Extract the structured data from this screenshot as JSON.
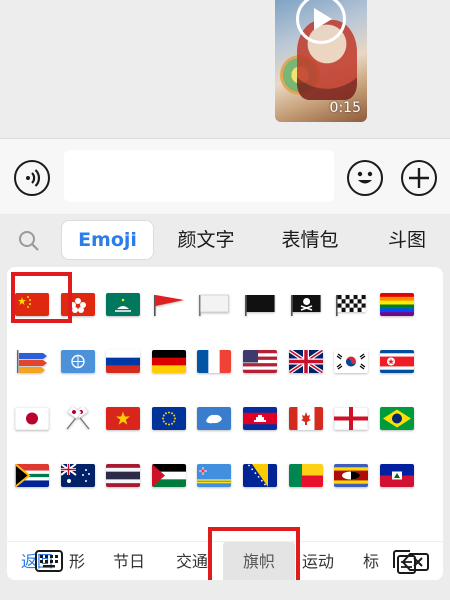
{
  "chat": {
    "video_duration": "0:15"
  },
  "input_bar": {
    "voice_icon": "voice-icon",
    "text_value": "",
    "emoji_icon": "smiley-icon",
    "plus_icon": "plus-icon"
  },
  "panel_tabs": [
    {
      "label": "Emoji",
      "active": true
    },
    {
      "label": "颜文字",
      "active": false
    },
    {
      "label": "表情包",
      "active": false
    },
    {
      "label": "斗图",
      "active": false
    }
  ],
  "flags": [
    "China",
    "Hong Kong",
    "Macau",
    "Red triangular flag",
    "White flag",
    "Black flag",
    "Pirate flag",
    "Chequered flag",
    "Rainbow flag",
    "Carp streamer",
    "United Nations",
    "Russia",
    "Germany",
    "France",
    "United States",
    "United Kingdom",
    "South Korea",
    "North Korea",
    "Japan",
    "Crossed flags",
    "Vietnam",
    "European Union",
    "Antarctica",
    "Cambodia",
    "Canada",
    "England",
    "Brazil",
    "South Africa",
    "Australia",
    "Thailand",
    "Palestine",
    "Aruba",
    "Bosnia and Herzegovina",
    "Benin",
    "Eswatini",
    "Haiti"
  ],
  "categories": {
    "back": "返回",
    "items": [
      "形",
      "节日",
      "交通",
      "旗帜",
      "运动",
      "标"
    ],
    "current": "旗帜"
  },
  "colors": {
    "accent_blue": "#2b7de9",
    "highlight_red": "#e01b1b"
  }
}
